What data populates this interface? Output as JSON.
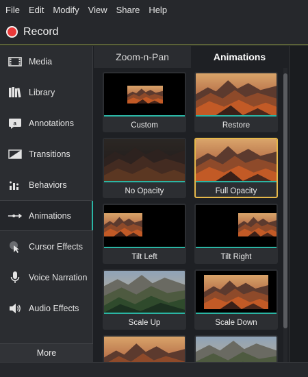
{
  "menu": [
    "File",
    "Edit",
    "Modify",
    "View",
    "Share",
    "Help"
  ],
  "record": {
    "label": "Record",
    "color": "#ea3a3a"
  },
  "sidebar": {
    "items": [
      {
        "label": "Media",
        "icon": "film-strip-icon"
      },
      {
        "label": "Library",
        "icon": "books-icon"
      },
      {
        "label": "Annotations",
        "icon": "speech-bubble-icon"
      },
      {
        "label": "Transitions",
        "icon": "transition-icon"
      },
      {
        "label": "Behaviors",
        "icon": "behaviors-icon"
      },
      {
        "label": "Animations",
        "icon": "animation-arrow-icon",
        "active": true
      },
      {
        "label": "Cursor Effects",
        "icon": "cursor-icon"
      },
      {
        "label": "Voice Narration",
        "icon": "microphone-icon"
      },
      {
        "label": "Audio Effects",
        "icon": "speaker-icon"
      }
    ],
    "more_label": "More"
  },
  "tabs": [
    {
      "label": "Zoom-n-Pan",
      "active": false
    },
    {
      "label": "Animations",
      "active": true
    }
  ],
  "cards": [
    {
      "label": "Custom"
    },
    {
      "label": "Restore"
    },
    {
      "label": "No Opacity"
    },
    {
      "label": "Full Opacity",
      "selected": true
    },
    {
      "label": "Tilt Left"
    },
    {
      "label": "Tilt Right"
    },
    {
      "label": "Scale Up"
    },
    {
      "label": "Scale Down"
    },
    {
      "label": ""
    },
    {
      "label": ""
    }
  ],
  "colors": {
    "accent": "#2bb5a4",
    "selected_border": "#e6b84a",
    "record_line": "#a3b34a"
  }
}
